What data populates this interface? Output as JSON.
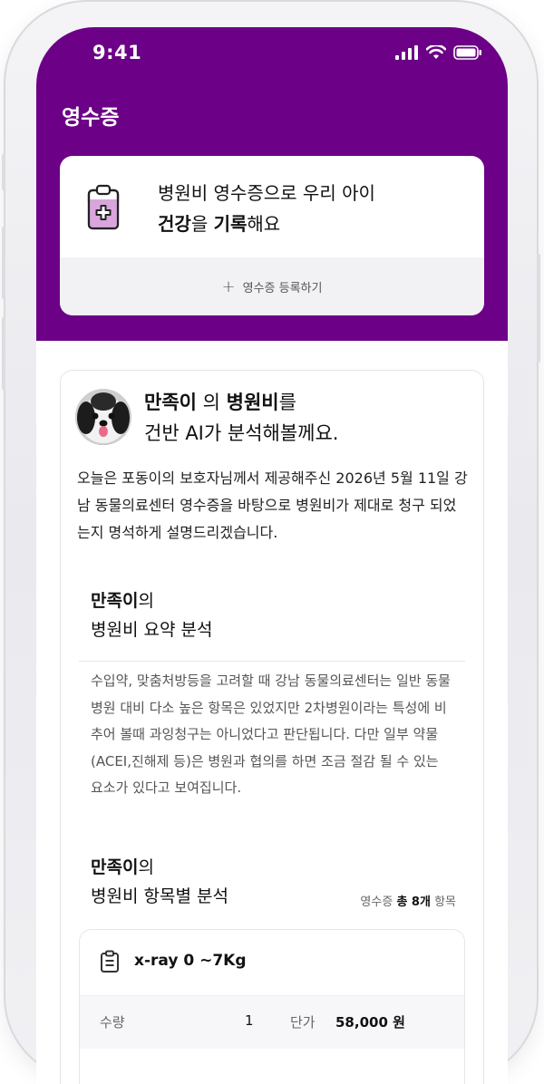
{
  "status": {
    "time": "9:41"
  },
  "header": {
    "title": "영수증"
  },
  "promo": {
    "line1": "병원비 영수증으로 우리 아이",
    "line2_part1": "건강",
    "line2_part2": "을 ",
    "line2_part3": "기록",
    "line2_part4": "해요",
    "register_label": "영수증 등록하기",
    "register_icon": "plus-icon"
  },
  "analysis": {
    "pet_name": "만족이",
    "title_part2": " 의 ",
    "title_part3": "병원비",
    "title_part4": "를",
    "title_line2": "건반 AI가 분석해볼께요.",
    "description": "오늘은 포동이의 보호자님께서 제공해주신 2026년 5월 11일 강남 동물의료센터 영수증을 바탕으로 병원비가 제대로 청구 되었는지 명석하게 설명드리겠습니다.",
    "summary": {
      "name": "만족이",
      "suffix": "의",
      "title": "병원비 요약 분석",
      "text": "수입약, 맞춤처방등을 고려할 때 강남 동물의료센터는 일반 동물병원 대비 다소 높은 항목은 있었지만 2차병원이라는 특성에 비추어 볼때 과잉청구는 아니었다고 판단됩니다. 다만 일부 약물(ACEI,진해제 등)은 병원과 협의를 하면 조금 절감 될 수 있는 요소가 있다고 보여집니다."
    },
    "items_section": {
      "name": "만족이",
      "suffix": "의",
      "title": "병원비 항목별 분석",
      "count_prefix": "영수증 ",
      "count_value": "총 8개",
      "count_suffix": " 항목"
    },
    "items": [
      {
        "name": "x-ray 0 ~7Kg",
        "qty_label": "수량",
        "qty": "1",
        "price_label": "단가",
        "price": "58,000 원"
      }
    ]
  }
}
